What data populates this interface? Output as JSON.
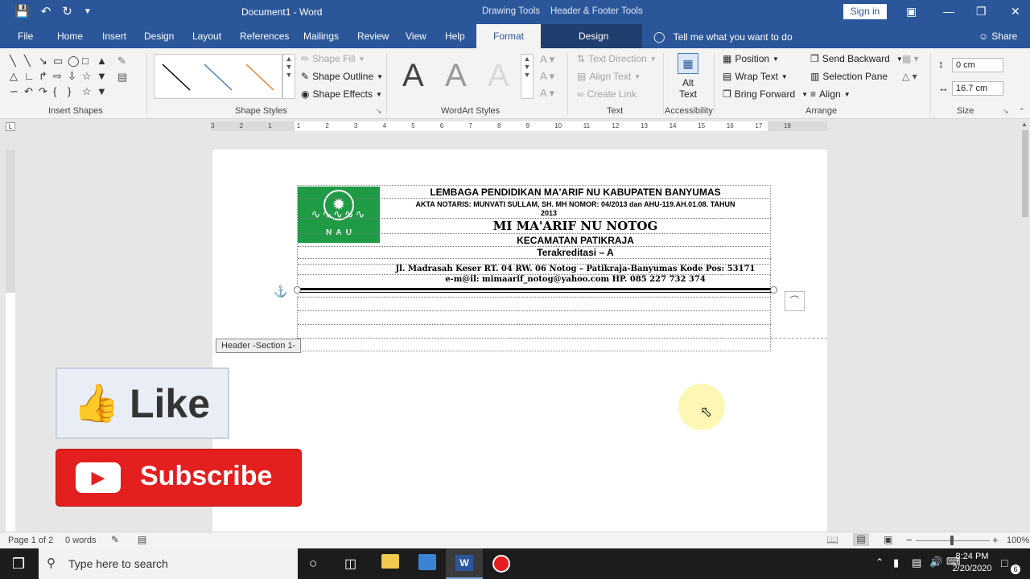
{
  "titlebar": {
    "document_title": "Document1 - Word",
    "context_tab_groups": [
      "Drawing Tools",
      "Header & Footer Tools"
    ],
    "signin_label": "Sign in"
  },
  "tabs": {
    "items": [
      "File",
      "Home",
      "Insert",
      "Design",
      "Layout",
      "References",
      "Mailings",
      "Review",
      "View",
      "Help"
    ],
    "context_format": "Format",
    "context_design": "Design",
    "tell_me": "Tell me what you want to do",
    "share": "Share"
  },
  "ribbon": {
    "insert_shapes_label": "Insert Shapes",
    "shape_styles_label": "Shape Styles",
    "shape_fill": "Shape Fill",
    "shape_outline": "Shape Outline",
    "shape_effects": "Shape Effects",
    "wordart_styles_label": "WordArt Styles",
    "wordart_letter": "A",
    "text_label": "Text",
    "text_direction": "Text Direction",
    "align_text": "Align Text",
    "create_link": "Create Link",
    "accessibility_label": "Accessibility",
    "alt_text_line1": "Alt",
    "alt_text_line2": "Text",
    "arrange_label": "Arrange",
    "position": "Position",
    "wrap_text": "Wrap Text",
    "bring_forward": "Bring Forward",
    "send_backward": "Send Backward",
    "selection_pane": "Selection Pane",
    "align": "Align",
    "size_label": "Size",
    "height_value": "0 cm",
    "width_value": "16.7 cm"
  },
  "ruler": {
    "ticks": [
      "3",
      "2",
      "1",
      "1",
      "2",
      "3",
      "4",
      "5",
      "6",
      "7",
      "8",
      "9",
      "10",
      "11",
      "12",
      "13",
      "14",
      "15",
      "16",
      "17",
      "18"
    ]
  },
  "letterhead": {
    "line1": "LEMBAGA PENDIDIKAN MA'ARIF NU KABUPATEN BANYUMAS",
    "line2": "AKTA NOTARIS: MUNVATI SULLAM, SH. MH NOMOR: 04/2013 dan  AHU-119.AH.01.08. TAHUN",
    "line2b": "2013",
    "line3": "MI MA'ARIF NU NOTOG",
    "line4": "KECAMATAN PATIKRAJA",
    "line5": "Terakreditasi – A",
    "line6": "Jl. Madrasah Keser RT. 04 RW. 06 Notog – Patikraja-Banyumas Kode Pos: 53171",
    "line7": "e-m@il: mimaarif_notog@yahoo.com HP. 085 227 732 374",
    "logo_letters": "N  A  U"
  },
  "page": {
    "header_tag": "Header -Section 1-"
  },
  "overlays": {
    "like_text": "Like",
    "subscribe_text": "Subscribe"
  },
  "statusbar": {
    "page_info": "Page 1 of 2",
    "word_count": "0 words",
    "zoom": "100%"
  },
  "taskbar": {
    "search_placeholder": "Type here to search",
    "time": "8:24 PM",
    "date": "2/20/2020",
    "notification_count": "6"
  },
  "colors": {
    "word_blue": "#2b579a",
    "context_dark": "#203f6e",
    "logo_green": "#1f9a45",
    "subscribe_red": "#e31f1f"
  }
}
